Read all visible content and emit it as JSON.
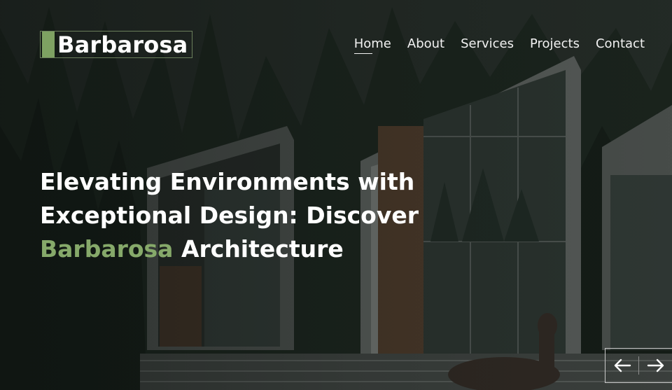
{
  "brand": {
    "name": "Barbarosa",
    "accent_color": "#7ea262"
  },
  "nav": {
    "items": [
      {
        "label": "Home",
        "active": true
      },
      {
        "label": "About",
        "active": false
      },
      {
        "label": "Services",
        "active": false
      },
      {
        "label": "Projects",
        "active": false
      },
      {
        "label": "Contact",
        "active": false
      }
    ]
  },
  "hero": {
    "headline_line1": "Elevating Environments with",
    "headline_line2": "Exceptional Design: Discover",
    "headline_accent": "Barbarosa",
    "headline_end": " Architecture",
    "accent_color": "#86a96a"
  },
  "slider": {
    "prev_icon": "arrow-left-icon",
    "next_icon": "arrow-right-icon"
  }
}
